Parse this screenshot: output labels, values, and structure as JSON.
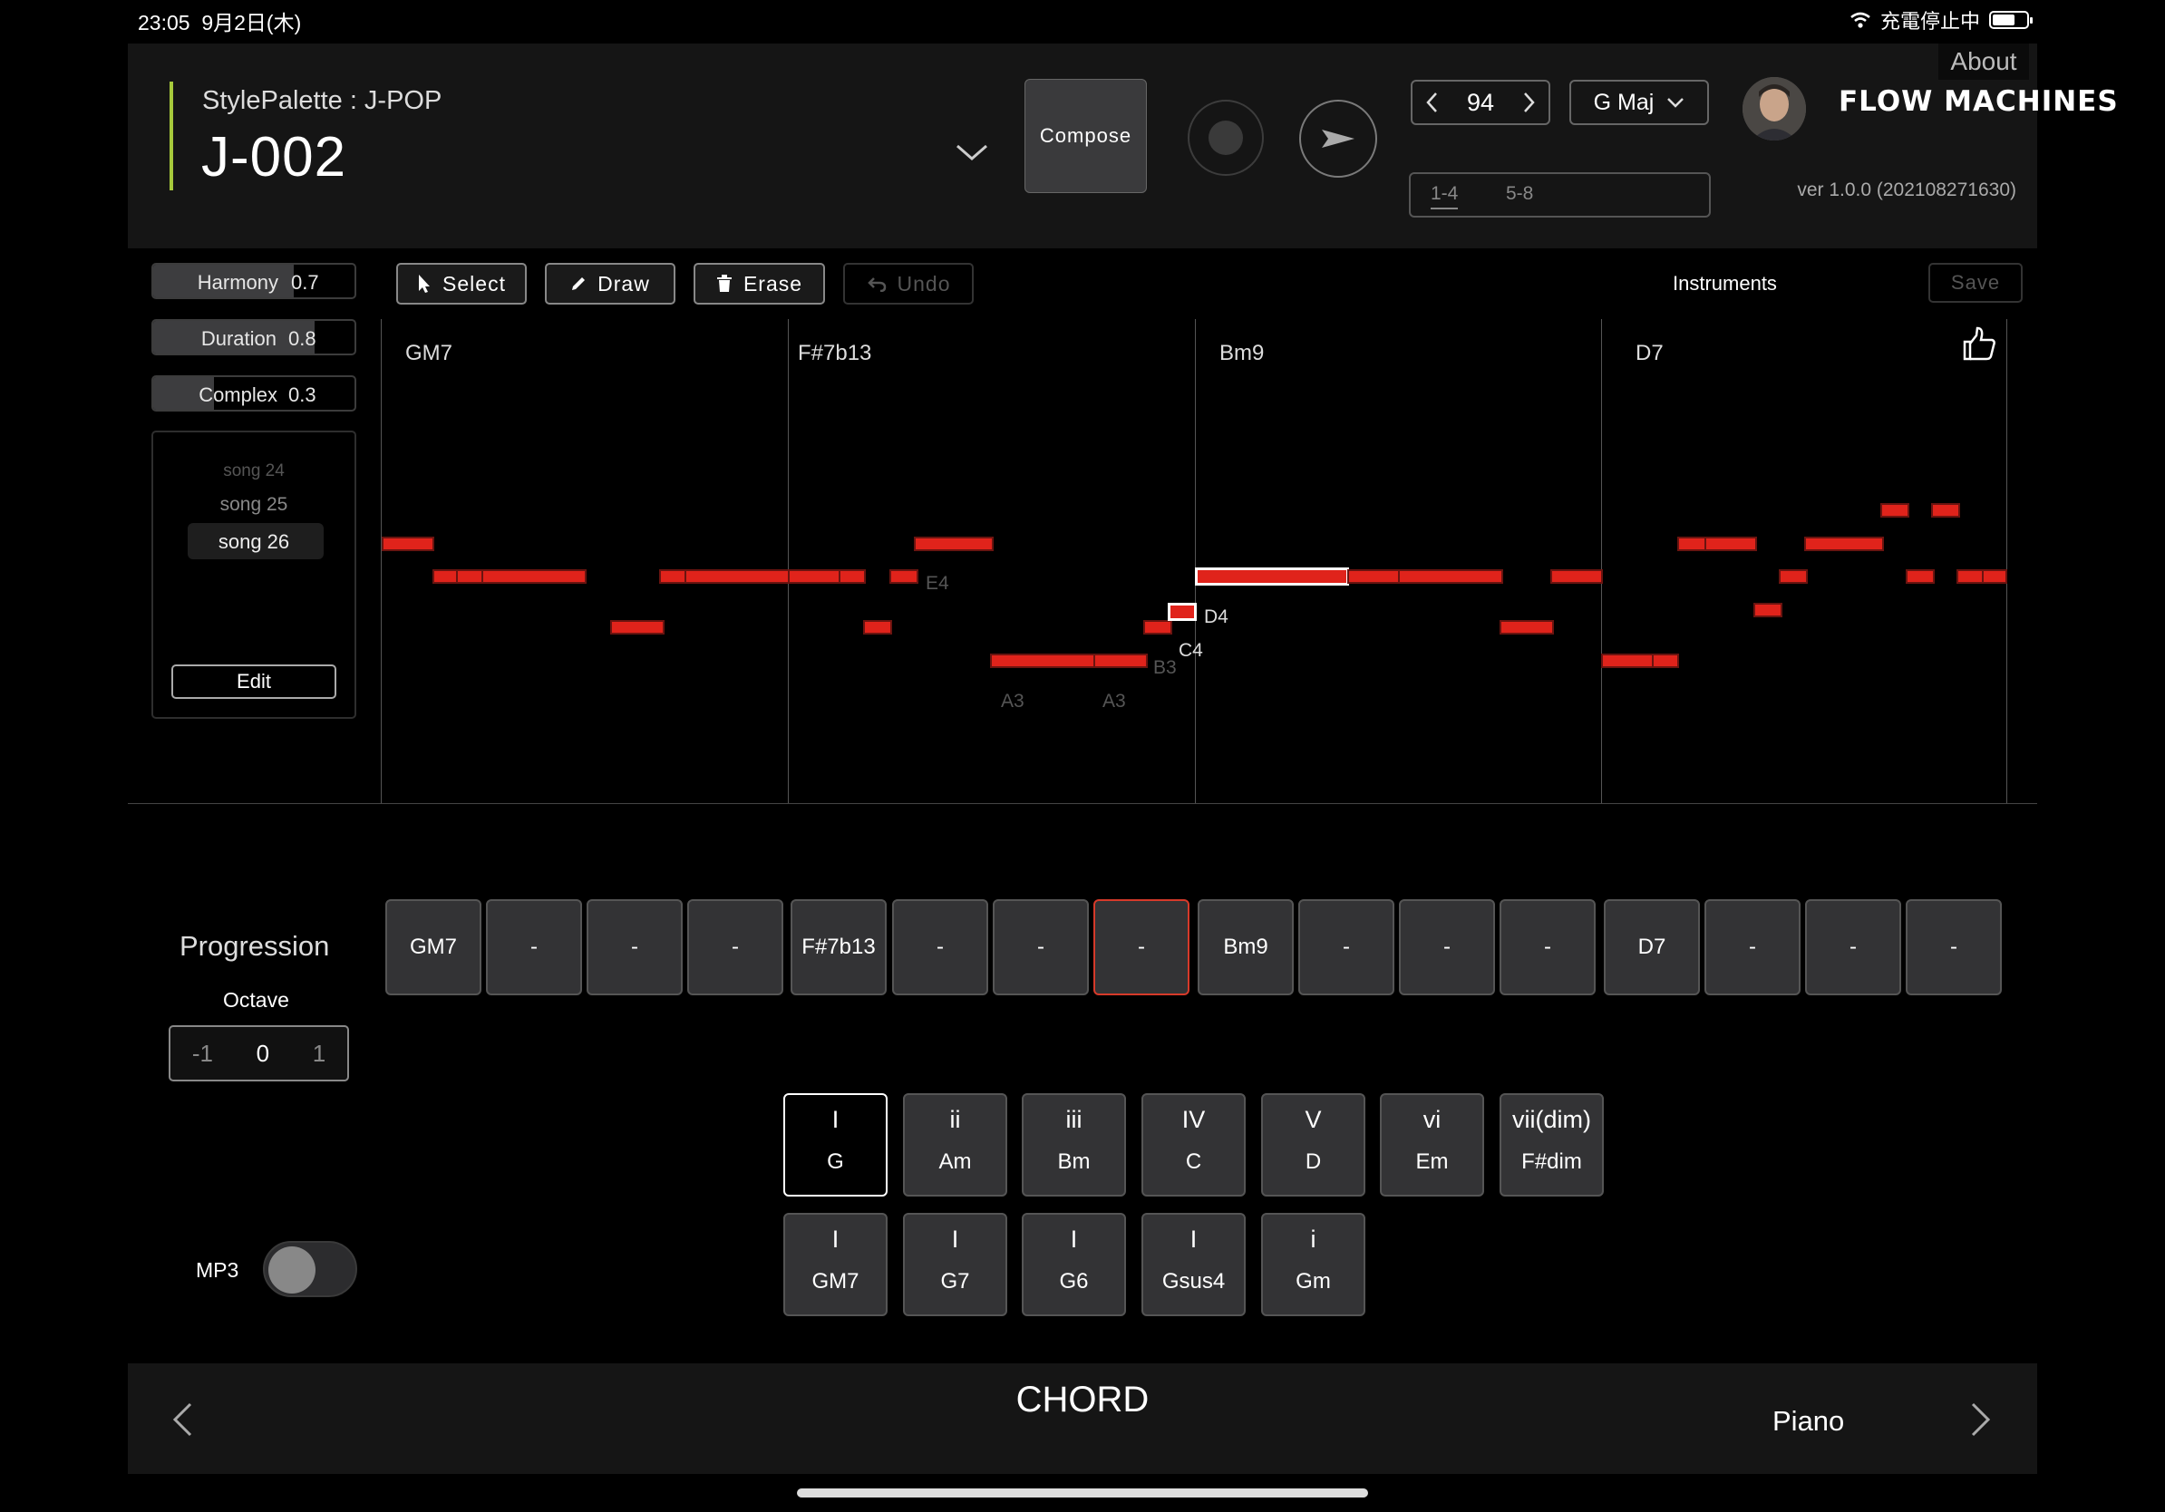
{
  "status": {
    "time": "23:05",
    "date": "9月2日(木)",
    "charging": "充電停止中"
  },
  "header": {
    "style_palette": "StylePalette : J-POP",
    "song_title": "J-002",
    "compose_label": "Compose",
    "tempo": "94",
    "key": "G Maj",
    "bars_tab_1": "1-4",
    "bars_tab_2": "5-8",
    "logo": "FLOW MACHINES",
    "about": "About",
    "version": "ver 1.0.0 (202108271630)"
  },
  "params": {
    "harmony": {
      "label": "Harmony",
      "value": "0.7"
    },
    "duration": {
      "label": "Duration",
      "value": "0.8"
    },
    "complex": {
      "label": "Complex",
      "value": "0.3"
    }
  },
  "songs": {
    "items": [
      "song 24",
      "song 25",
      "song 26"
    ],
    "selected": "song 26",
    "edit_label": "Edit"
  },
  "toolbar": {
    "select": "Select",
    "draw": "Draw",
    "erase": "Erase",
    "undo": "Undo",
    "instruments": "Instruments",
    "save": "Save"
  },
  "roll": {
    "chords": [
      "GM7",
      "F#7b13",
      "Bm9",
      "D7"
    ],
    "note_labels": {
      "e4": "E4",
      "d4": "D4",
      "c4": "C4",
      "b3": "B3",
      "a3_1": "A3",
      "a3_2": "A3"
    }
  },
  "progression": {
    "title": "Progression",
    "octave_label": "Octave",
    "octave_values": [
      "-1",
      "0",
      "1"
    ],
    "slots": [
      "GM7",
      "-",
      "-",
      "-",
      "F#7b13",
      "-",
      "-",
      "-",
      "Bm9",
      "-",
      "-",
      "-",
      "D7",
      "-",
      "-",
      "-"
    ]
  },
  "diatonic": [
    {
      "degree": "I",
      "name": "G"
    },
    {
      "degree": "ii",
      "name": "Am"
    },
    {
      "degree": "iii",
      "name": "Bm"
    },
    {
      "degree": "IV",
      "name": "C"
    },
    {
      "degree": "V",
      "name": "D"
    },
    {
      "degree": "vi",
      "name": "Em"
    },
    {
      "degree": "vii(dim)",
      "name": "F#dim"
    }
  ],
  "variations": [
    {
      "degree": "I",
      "name": "GM7"
    },
    {
      "degree": "I",
      "name": "G7"
    },
    {
      "degree": "I",
      "name": "G6"
    },
    {
      "degree": "I",
      "name": "Gsus4"
    },
    {
      "degree": "i",
      "name": "Gm"
    }
  ],
  "mp3_label": "MP3",
  "footer": {
    "title": "CHORD",
    "instrument": "Piano"
  },
  "colors": {
    "accent": "#a6c93b",
    "note": "#e0231b",
    "active_slot": "#d63a2a"
  }
}
